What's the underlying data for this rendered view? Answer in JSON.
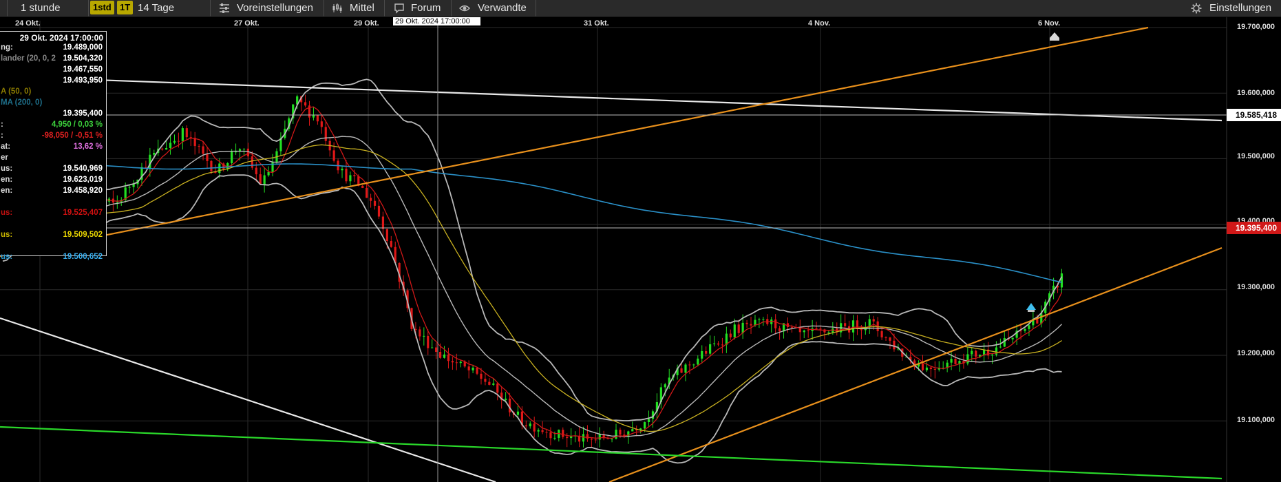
{
  "toolbar": {
    "timeframe": "1 stunde",
    "badge_1std": "1std",
    "badge_1T": "1T",
    "period": "14 Tage",
    "presets": "Voreinstellungen",
    "indicator": "Mittel",
    "forum": "Forum",
    "related": "Verwandte",
    "settings": "Einstellungen"
  },
  "dates": [
    "24 Okt.",
    "27 Okt.",
    "29 Okt.",
    "31 Okt.",
    "4 Nov.",
    "6 Nov."
  ],
  "crosshair_label": "29 Okt. 2024 17:00:00",
  "info_panel": {
    "header": "29 Okt. 2024 17:00:00",
    "rows": [
      {
        "k": "ng:",
        "v": "19.489,000",
        "kc": "#ddd",
        "vc": "#ffffff"
      },
      {
        "k": "lander (20, 0, 2",
        "v": "19.504,320",
        "kc": "#888",
        "vc": "#ffffff"
      },
      {
        "k": "",
        "v": "19.467,550",
        "kc": "#ddd",
        "vc": "#ffffff"
      },
      {
        "k": "",
        "v": "19.493,950",
        "kc": "#ddd",
        "vc": "#ffffff"
      },
      {
        "k": "A (50, 0)",
        "v": "",
        "kc": "#8a7a00",
        "vc": "#ffffff"
      },
      {
        "k": "MA (200, 0)",
        "v": "",
        "kc": "#1e6f8a",
        "vc": "#ffffff"
      },
      {
        "k": "",
        "v": "19.395,400",
        "kc": "#ddd",
        "vc": "#ffffff"
      },
      {
        "k": ":",
        "v": "4,950 / 0,03 %",
        "kc": "#ddd",
        "vc": "#3cd23c"
      },
      {
        "k": ":",
        "v": "-98,050 / -0,51 %",
        "kc": "#ddd",
        "vc": "#e02020"
      },
      {
        "k": "at:",
        "v": "13,62 %",
        "kc": "#ddd",
        "vc": "#e070e0"
      },
      {
        "k": "er",
        "v": "",
        "kc": "#ddd",
        "vc": "#ffffff"
      },
      {
        "k": "us:",
        "v": "19.540,969",
        "kc": "#ddd",
        "vc": "#ffffff"
      },
      {
        "k": "en:",
        "v": "19.623,019",
        "kc": "#ddd",
        "vc": "#ffffff"
      },
      {
        "k": "en:",
        "v": "19.458,920",
        "kc": "#ddd",
        "vc": "#ffffff"
      },
      {
        "k": "",
        "v": "",
        "kc": "#ddd",
        "vc": "#ffffff"
      },
      {
        "k": "us:",
        "v": "19.525,407",
        "kc": "#c01010",
        "vc": "#d01010"
      },
      {
        "k": "",
        "v": "",
        "kc": "#ddd",
        "vc": "#ffffff"
      },
      {
        "k": "us:",
        "v": "19.509,502",
        "kc": "#c8b400",
        "vc": "#e8d400"
      },
      {
        "k": "",
        "v": "",
        "kc": "#ddd",
        "vc": "#ffffff"
      },
      {
        "k": "us:",
        "v": "19.500,652",
        "kc": "#2a9ad0",
        "vc": "#3ab0f0"
      }
    ]
  },
  "price_axis": {
    "labels": [
      "19.700,000",
      "19.600,000",
      "19.500,000",
      "19.400,000",
      "19.300,000",
      "19.200,000",
      "19.100,000"
    ],
    "current_price": "19.395,400",
    "level_price": "19.585,418",
    "current_color": "#d01818",
    "level_color": "#ffffff"
  },
  "colors": {
    "bullish": "#22e022",
    "bearish": "#e01818",
    "bollinger": "#b8b8b8",
    "ema_short": "#d01818",
    "sma50": "#c8b020",
    "sma200": "#2a90c8",
    "trend_orange": "#e8901c",
    "trend_white": "#e8e8e8",
    "trend_green": "#2ad82a"
  }
}
